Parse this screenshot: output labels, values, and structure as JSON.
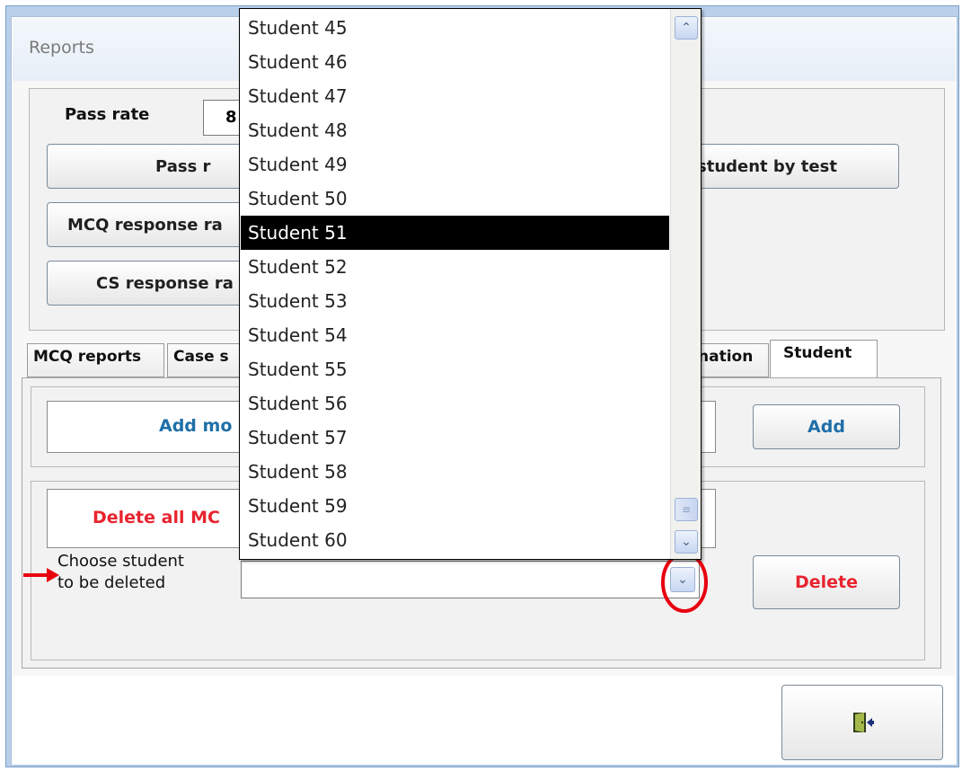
{
  "window": {
    "title": "Reports"
  },
  "top_panel": {
    "pass_rate_label": "Pass rate",
    "pass_rate_value": "8",
    "pass_button": "Pass r",
    "student_by_test_button": "student by test",
    "mcq_response_button": "MCQ response ra",
    "cs_response_button": "CS response ra"
  },
  "tabs": [
    {
      "label": "MCQ reports"
    },
    {
      "label": "Case s"
    },
    {
      "label": "nation"
    },
    {
      "label": "Student"
    }
  ],
  "add_section": {
    "add_mc_label": "Add mo",
    "add_button": "Add"
  },
  "delete_section": {
    "delete_all_label": "Delete all MC",
    "choose_student_line1": "Choose student",
    "choose_student_line2": "to be deleted",
    "combo_value": "",
    "delete_button": "Delete"
  },
  "dropdown": {
    "items": [
      "Student 45",
      "Student 46",
      "Student 47",
      "Student 48",
      "Student 49",
      "Student 50",
      "Student 51",
      "Student 52",
      "Student 53",
      "Student 54",
      "Student 55",
      "Student 56",
      "Student 57",
      "Student 58",
      "Student 59",
      "Student 60"
    ],
    "selected": "Student 51"
  },
  "colors": {
    "accent_blue": "#1f6fa8",
    "delete_red": "#e8242f",
    "annotation_red": "#e8000f",
    "selection_bg": "#000000"
  },
  "icons": {
    "exit": "exit-door-icon",
    "scroll_up": "chevron-up-icon",
    "scroll_down": "chevron-down-icon",
    "combo_arrow": "chevron-down-icon",
    "annotation_arrow": "red-arrow-icon",
    "annotation_circle": "red-circle-highlight"
  }
}
